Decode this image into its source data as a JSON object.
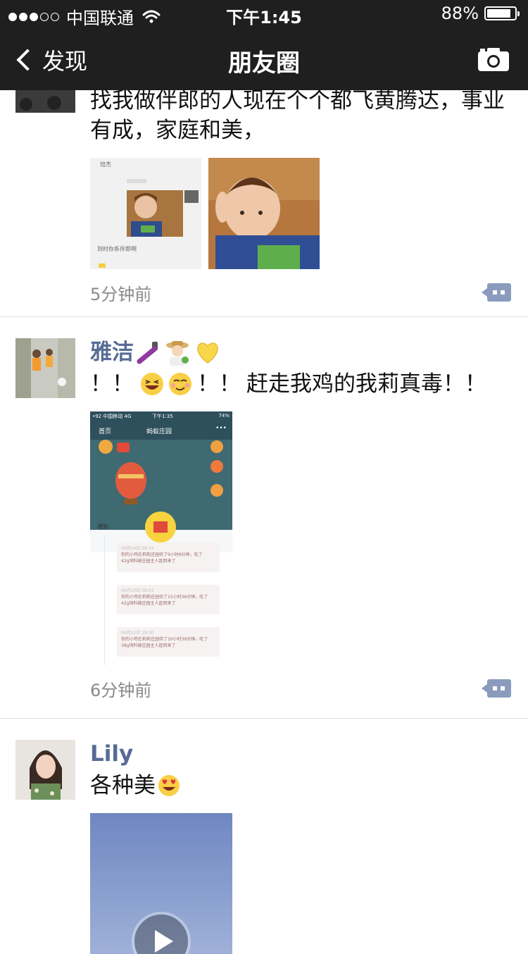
{
  "status_bar": {
    "carrier": "中国联通",
    "time": "下午1:45",
    "battery": "88%",
    "battery_level": 0.88
  },
  "navbar": {
    "back_label": "发现",
    "title": "朋友圈"
  },
  "posts": [
    {
      "name": "",
      "text": "找我做伴郎的人现在个个都飞黄腾达，事业有成，家庭和美，",
      "time": "5分钟前",
      "chat_shot": {
        "name": "培杰",
        "caption": "到时你系伴郎啊"
      }
    },
    {
      "name": "雅洁",
      "text_prefix": "！！",
      "text_mid": "！！",
      "text_rest": "赶走我鸡的我莉真毒！！",
      "time": "6分钟前",
      "screenshot": {
        "carrier": "•92 中国移动 4G",
        "time": "下午1:35",
        "battery": "74%",
        "back": "首页",
        "title": "蚂蚁庄园",
        "more": "•••",
        "notice": "通知",
        "items": [
          {
            "date": "06月24日 09:34",
            "line1": "你的小鸡在莉莉庄园待了9小时8分钟，吃了",
            "line2": "42g饲料被庄园主人赶回来了"
          },
          {
            "date": "06月23日 00:03",
            "line1": "你的小鸡在莉莉庄园待了15小时36分钟，吃了",
            "line2": "42g饲料被庄园主人赶回来了"
          },
          {
            "date": "06月22日 19:30",
            "line1": "你的小鸡在莉莉庄园待了10小时39分钟，吃了",
            "line2": "38g饲料被庄园主人赶回来了"
          }
        ]
      }
    },
    {
      "name": "Lily",
      "text": "各种美",
      "has_video": true
    }
  ],
  "colors": {
    "header_bg": "#1f1f1f",
    "name_color": "#576b95",
    "time_color": "#8a8a8a",
    "comment_btn": "#8a9bbd"
  }
}
